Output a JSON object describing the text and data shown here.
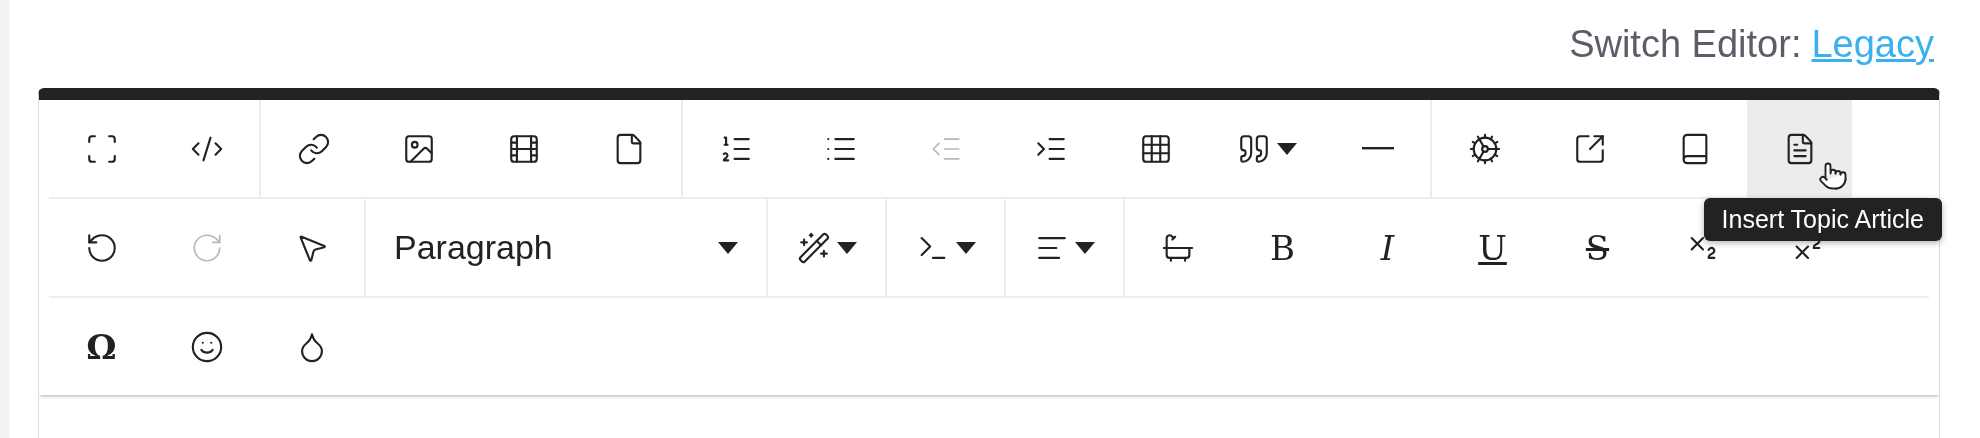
{
  "switch_editor": {
    "label": "Switch Editor:",
    "link": "Legacy"
  },
  "toolbar": {
    "rows": [
      {
        "groups": [
          {
            "buttons": [
              {
                "kind": "icon",
                "disabled": false,
                "hovered": false
              },
              {
                "kind": "icon",
                "disabled": false,
                "hovered": false
              }
            ]
          },
          {
            "buttons": [
              {
                "kind": "icon",
                "disabled": false,
                "hovered": false
              },
              {
                "kind": "icon",
                "disabled": false,
                "hovered": false
              },
              {
                "kind": "icon",
                "disabled": false,
                "hovered": false
              },
              {
                "kind": "icon",
                "disabled": false,
                "hovered": false
              }
            ]
          },
          {
            "buttons": [
              {
                "kind": "icon",
                "disabled": false,
                "hovered": false
              },
              {
                "kind": "icon",
                "disabled": false,
                "hovered": false
              },
              {
                "kind": "icon",
                "disabled": true,
                "hovered": false
              },
              {
                "kind": "icon",
                "disabled": false,
                "hovered": false
              },
              {
                "kind": "icon",
                "disabled": false,
                "hovered": false
              },
              {
                "kind": "icon-menu",
                "disabled": false,
                "hovered": false
              },
              {
                "kind": "icon",
                "disabled": false,
                "hovered": false
              }
            ]
          },
          {
            "buttons": [
              {
                "kind": "icon",
                "disabled": false,
                "hovered": false
              },
              {
                "kind": "icon",
                "disabled": false,
                "hovered": false
              },
              {
                "kind": "icon",
                "disabled": false,
                "hovered": false
              },
              {
                "kind": "icon",
                "disabled": false,
                "hovered": true
              }
            ]
          }
        ]
      },
      {
        "groups": [
          {
            "buttons": [
              {
                "kind": "icon",
                "disabled": false,
                "hovered": false
              },
              {
                "kind": "icon",
                "disabled": true,
                "hovered": false
              },
              {
                "kind": "icon",
                "disabled": false,
                "hovered": false
              }
            ]
          },
          {
            "buttons": [
              {
                "kind": "select",
                "label": "Paragraph",
                "disabled": false,
                "hovered": false
              }
            ]
          },
          {
            "buttons": [
              {
                "kind": "icon-menu",
                "disabled": false,
                "hovered": false
              }
            ]
          },
          {
            "buttons": [
              {
                "kind": "icon-menu",
                "disabled": false,
                "hovered": false
              }
            ]
          },
          {
            "buttons": [
              {
                "kind": "icon-menu",
                "disabled": false,
                "hovered": false
              }
            ]
          },
          {
            "buttons": [
              {
                "kind": "icon",
                "disabled": false,
                "hovered": false
              },
              {
                "kind": "glyph",
                "label": "B",
                "disabled": false,
                "hovered": false
              },
              {
                "kind": "glyph",
                "label": "I",
                "disabled": false,
                "hovered": false
              },
              {
                "kind": "glyph",
                "label": "U",
                "disabled": false,
                "hovered": false
              },
              {
                "kind": "glyph",
                "label": "S",
                "disabled": false,
                "hovered": false
              },
              {
                "kind": "icon",
                "disabled": false,
                "hovered": false
              },
              {
                "kind": "icon",
                "disabled": false,
                "hovered": false
              }
            ]
          }
        ]
      },
      {
        "groups": [
          {
            "buttons": [
              {
                "kind": "glyph",
                "label": "Ω",
                "disabled": false,
                "hovered": false
              },
              {
                "kind": "icon",
                "disabled": false,
                "hovered": false
              },
              {
                "kind": "icon",
                "disabled": false,
                "hovered": false
              }
            ]
          }
        ]
      }
    ]
  },
  "tooltip": "Insert Topic Article"
}
